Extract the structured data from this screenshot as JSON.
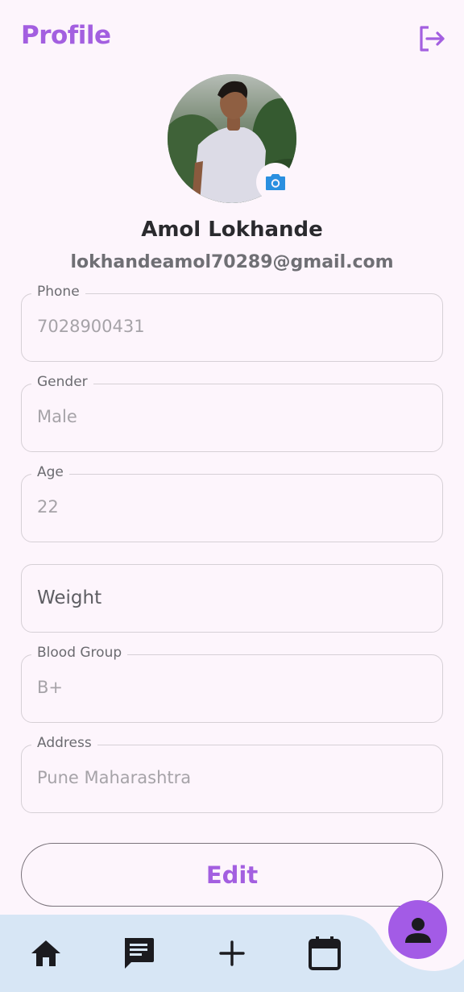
{
  "header": {
    "title": "Profile",
    "logout_icon": "logout-icon"
  },
  "profile": {
    "avatar_alt": "profile-photo",
    "camera_icon": "camera-icon",
    "name": "Amol Lokhande",
    "email": "lokhandeamol70289@gmail.com"
  },
  "fields": {
    "phone": {
      "label": "Phone",
      "value": "7028900431"
    },
    "gender": {
      "label": "Gender",
      "value": "Male"
    },
    "age": {
      "label": "Age",
      "value": "22"
    },
    "weight": {
      "placeholder": "Weight"
    },
    "blood_group": {
      "label": "Blood Group",
      "value": "B+"
    },
    "address": {
      "label": "Address",
      "value": "Pune Maharashtra"
    }
  },
  "actions": {
    "edit_label": "Edit"
  },
  "bottom_nav": {
    "items": [
      {
        "icon": "home-icon"
      },
      {
        "icon": "chat-icon"
      },
      {
        "icon": "add-icon"
      },
      {
        "icon": "calendar-icon"
      }
    ],
    "active_icon": "person-icon"
  },
  "colors": {
    "accent": "#a35fe0",
    "background": "#fdf5fc",
    "nav_background": "#d7e6f5",
    "camera_icon": "#2a8fe0"
  }
}
